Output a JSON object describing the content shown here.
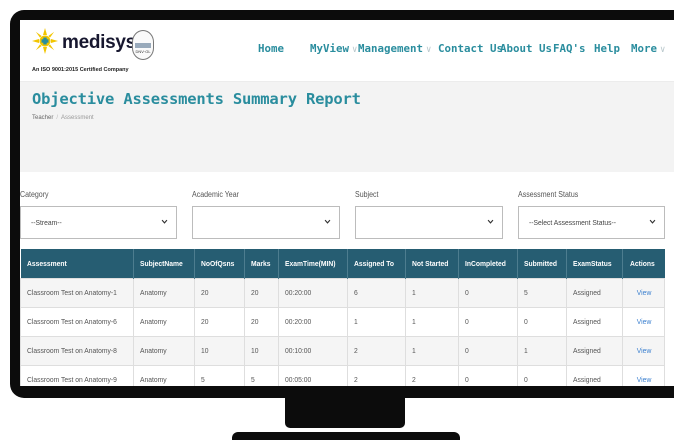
{
  "brand": {
    "name": "medisys",
    "tagline": "An ISO 9001:2015 Certified Company",
    "badge_text": "DNV·GL",
    "sun_color": "#f2c500",
    "dot_color": "#2a8d9e"
  },
  "nav": [
    {
      "label": "Home",
      "has_caret": false
    },
    {
      "label": "MyView",
      "has_caret": true
    },
    {
      "label": "Management",
      "has_caret": true
    },
    {
      "label": "Contact Us",
      "has_caret": false
    },
    {
      "label": "About Us",
      "has_caret": false
    },
    {
      "label": "FAQ's",
      "has_caret": false
    },
    {
      "label": "Help",
      "has_caret": false
    },
    {
      "label": "More",
      "has_caret": true
    }
  ],
  "page": {
    "title": "Objective Assessments Summary Report",
    "breadcrumb": [
      "Teacher",
      "Assessment"
    ]
  },
  "filters": [
    {
      "label": "Category",
      "value": "--Stream--"
    },
    {
      "label": "Academic Year",
      "value": ""
    },
    {
      "label": "Subject",
      "value": ""
    },
    {
      "label": "Assessment Status",
      "value": "--Select Assessment Status--"
    }
  ],
  "table": {
    "columns": [
      "Assessment",
      "SubjectName",
      "NoOfQsns",
      "Marks",
      "ExamTime(MIN)",
      "Assigned To",
      "Not Started",
      "InCompleted",
      "Submitted",
      "ExamStatus",
      "Actions"
    ],
    "rows": [
      [
        "Classroom Test on Anatomy-1",
        "Anatomy",
        "20",
        "20",
        "00:20:00",
        "6",
        "1",
        "0",
        "5",
        "Assigned",
        "View"
      ],
      [
        "Classroom Test on Anatomy-6",
        "Anatomy",
        "20",
        "20",
        "00:20:00",
        "1",
        "1",
        "0",
        "0",
        "Assigned",
        "View"
      ],
      [
        "Classroom Test on Anatomy-8",
        "Anatomy",
        "10",
        "10",
        "00:10:00",
        "2",
        "1",
        "0",
        "1",
        "Assigned",
        "View"
      ],
      [
        "Classroom Test on Anatomy-9",
        "Anatomy",
        "5",
        "5",
        "00:05:00",
        "2",
        "2",
        "0",
        "0",
        "Assigned",
        "View"
      ]
    ]
  },
  "colors": {
    "accent": "#2a8d9e",
    "table_header": "#265d72",
    "link": "#3a7fcf"
  }
}
